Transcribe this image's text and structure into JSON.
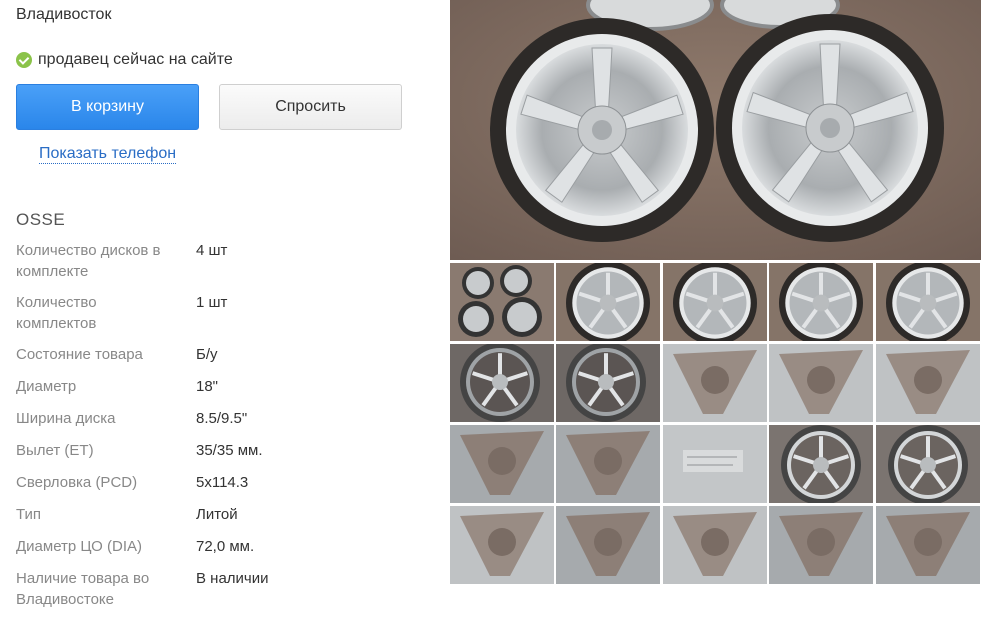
{
  "location": {
    "city": "Владивосток"
  },
  "seller": {
    "status": "продавец сейчас на сайте",
    "status_color": "#8bc34a"
  },
  "actions": {
    "cart_label": "В корзину",
    "ask_label": "Спросить",
    "phone_link": "Показать телефон"
  },
  "colors": {
    "primary": "#3a93f0",
    "link": "#2a6dc5"
  },
  "product": {
    "brand": "OSSE",
    "specs": [
      {
        "label": "Количество дисков в комплекте",
        "value": "4 шт"
      },
      {
        "label": "Количество комплектов",
        "value": "1 шт"
      },
      {
        "label": "Состояние товара",
        "value": "Б/у"
      },
      {
        "label": "Диаметр",
        "value": "18\""
      },
      {
        "label": "Ширина диска",
        "value": "8.5/9.5\""
      },
      {
        "label": "Вылет (ET)",
        "value": "35/35 мм."
      },
      {
        "label": "Сверловка (PCD)",
        "value": "5x114.3"
      },
      {
        "label": "Тип",
        "value": "Литой"
      },
      {
        "label": "Диаметр ЦО (DIA)",
        "value": "72,0 мм."
      },
      {
        "label": "Наличие товара во Владивостоке",
        "value": "В наличии"
      }
    ]
  },
  "gallery": {
    "main_image": "wheel-pair-photo",
    "thumbnails": [
      "four-wheels",
      "wheel-front",
      "wheel-front",
      "wheel-front",
      "wheel-front",
      "wheel-rear-dirty",
      "wheel-rear-dirty",
      "spoke-closeup",
      "spoke-closeup",
      "spoke-closeup",
      "hub-closeup",
      "hub-closeup",
      "label-closeup",
      "wheel-rear",
      "wheel-rear",
      "spoke-closeup",
      "hub-closeup",
      "spoke-closeup",
      "hub-closeup",
      "hub-closeup"
    ]
  }
}
